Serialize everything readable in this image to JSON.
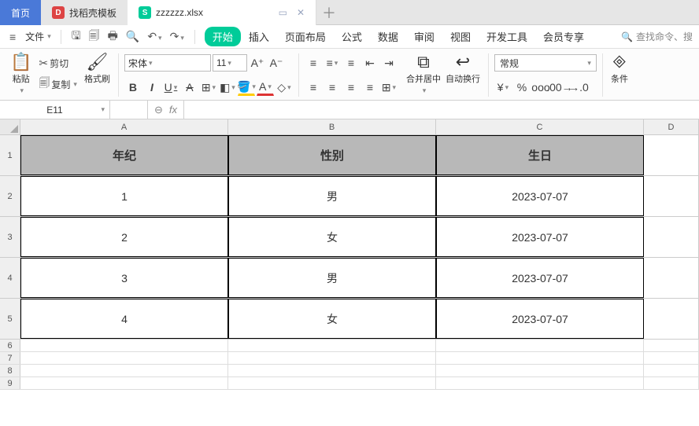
{
  "tabs": {
    "home": "首页",
    "template": "找稻壳模板",
    "doc": "zzzzzz.xlsx"
  },
  "file_menu": "文件",
  "ribbon_tabs": {
    "start": "开始",
    "insert": "插入",
    "layout": "页面布局",
    "formula": "公式",
    "data": "数据",
    "review": "审阅",
    "view": "视图",
    "dev": "开发工具",
    "member": "会员专享"
  },
  "search_placeholder": "查找命令、搜",
  "clipboard": {
    "paste": "粘贴",
    "cut": "剪切",
    "copy": "复制",
    "painter": "格式刷"
  },
  "font": {
    "name": "宋体",
    "size": "11"
  },
  "merge": "合并居中",
  "wrap": "自动换行",
  "numfmt": "常规",
  "cond": "条件",
  "namebox": "E11",
  "columns": [
    "A",
    "B",
    "C",
    "D"
  ],
  "headers": {
    "a": "年纪",
    "b": "性别",
    "c": "生日"
  },
  "rows": [
    {
      "n": "1",
      "a": "1",
      "b": "男",
      "c": "2023-07-07"
    },
    {
      "n": "2",
      "a": "2",
      "b": "女",
      "c": "2023-07-07"
    },
    {
      "n": "3",
      "a": "3",
      "b": "男",
      "c": "2023-07-07"
    },
    {
      "n": "4",
      "a": "4",
      "b": "女",
      "c": "2023-07-07"
    }
  ],
  "chart_data": {
    "type": "table",
    "columns": [
      "年纪",
      "性别",
      "生日"
    ],
    "rows": [
      [
        "1",
        "男",
        "2023-07-07"
      ],
      [
        "2",
        "女",
        "2023-07-07"
      ],
      [
        "3",
        "男",
        "2023-07-07"
      ],
      [
        "4",
        "女",
        "2023-07-07"
      ]
    ]
  }
}
